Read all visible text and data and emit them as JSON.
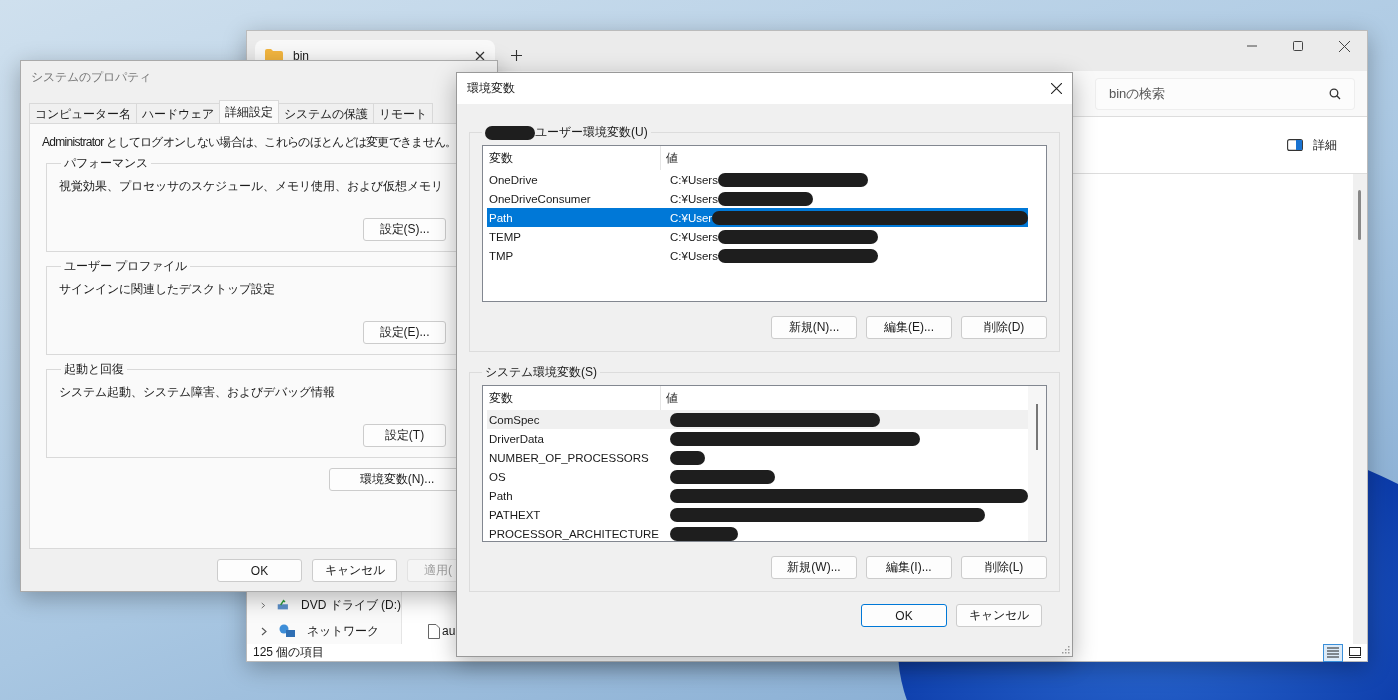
{
  "explorer": {
    "tab_title": "bin",
    "search": {
      "placeholder": "binの検索"
    },
    "details_button": "詳細",
    "sidebar": {
      "items": [
        {
          "label": "DVD ドライブ (D:)",
          "kind": "drive"
        },
        {
          "label": "ネットワーク",
          "kind": "network"
        }
      ]
    },
    "files": [
      {
        "name": "au"
      }
    ],
    "status_bar": "125 個の項目",
    "view_buttons": [
      {
        "kind": "details",
        "selected": true
      },
      {
        "kind": "tiles",
        "selected": false
      }
    ]
  },
  "system_properties": {
    "title": "システムのプロパティ",
    "tabs": [
      {
        "label": "コンピューター名",
        "selected": false
      },
      {
        "label": "ハードウェア",
        "selected": false
      },
      {
        "label": "詳細設定",
        "selected": true
      },
      {
        "label": "システムの保護",
        "selected": false
      },
      {
        "label": "リモート",
        "selected": false
      }
    ],
    "notice": "Administrator としてログオンしない場合は、これらのほとんどは変更できません。",
    "groups": [
      {
        "title": "パフォーマンス",
        "description": "視覚効果、プロセッサのスケジュール、メモリ使用、および仮想メモリ",
        "button": "設定(S)..."
      },
      {
        "title": "ユーザー プロファイル",
        "description": "サインインに関連したデスクトップ設定",
        "button": "設定(E)..."
      },
      {
        "title": "起動と回復",
        "description": "システム起動、システム障害、およびデバッグ情報",
        "button": "設定(T)"
      }
    ],
    "env_button": "環境変数(N)...",
    "buttons": [
      {
        "label": "OK",
        "disabled": false
      },
      {
        "label": "キャンセル",
        "disabled": false
      },
      {
        "label": "適用(",
        "disabled": true
      }
    ]
  },
  "env_dialog": {
    "title": "環境変数",
    "sections": [
      {
        "title": "ユーザー環境変数(U)",
        "title_redacted": true,
        "focused": true,
        "columns": [
          "変数",
          "値"
        ],
        "rows": [
          {
            "name": "OneDrive",
            "value": "C:¥Users",
            "redacted": true,
            "selected": false
          },
          {
            "name": "OneDriveConsumer",
            "value": "C:¥Users",
            "redacted": true,
            "selected": false
          },
          {
            "name": "Path",
            "value": "C:¥User",
            "redacted": true,
            "selected": true
          },
          {
            "name": "TEMP",
            "value": "C:¥Users",
            "redacted": true,
            "selected": false
          },
          {
            "name": "TMP",
            "value": "C:¥Users",
            "redacted": true,
            "selected": false
          }
        ],
        "buttons": [
          "新規(N)...",
          "編集(E)...",
          "削除(D)"
        ]
      },
      {
        "title": "システム環境変数(S)",
        "title_redacted": false,
        "focused": false,
        "columns": [
          "変数",
          "値"
        ],
        "rows": [
          {
            "name": "ComSpec",
            "redacted": true,
            "selected": true
          },
          {
            "name": "DriverData",
            "redacted": true,
            "selected": false
          },
          {
            "name": "NUMBER_OF_PROCESSORS",
            "redacted": true,
            "selected": false
          },
          {
            "name": "OS",
            "redacted": true,
            "selected": false
          },
          {
            "name": "Path",
            "redacted": true,
            "selected": false
          },
          {
            "name": "PATHEXT",
            "redacted": true,
            "selected": false
          },
          {
            "name": "PROCESSOR_ARCHITECTURE",
            "redacted": true,
            "selected": false
          }
        ],
        "buttons": [
          "新規(W)...",
          "編集(I)...",
          "削除(L)"
        ]
      }
    ],
    "buttons": [
      {
        "label": "OK",
        "default": true
      },
      {
        "label": "キャンセル",
        "default": false
      }
    ]
  }
}
